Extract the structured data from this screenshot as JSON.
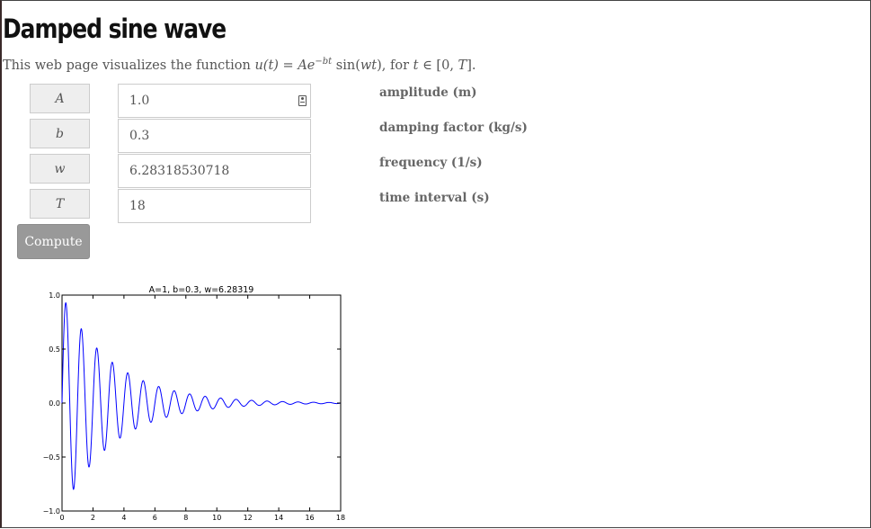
{
  "page": {
    "title": "Damped sine wave",
    "intro_prefix": "This web page visualizes the function ",
    "intro_func_lhs": "u(t)",
    "intro_eq": " = ",
    "intro_func_A": "Ae",
    "intro_func_exp": "−bt",
    "intro_sin": " sin(",
    "intro_wt": "wt",
    "intro_close": "),",
    "intro_for": "  for ",
    "intro_t": "t",
    "intro_in": " ∈ [0, ",
    "intro_T": "T",
    "intro_end": "]."
  },
  "form": {
    "params": [
      {
        "symbol": "A",
        "value": "1.0",
        "description": "amplitude (m)"
      },
      {
        "symbol": "b",
        "value": "0.3",
        "description": "damping factor (kg/s)"
      },
      {
        "symbol": "w",
        "value": "6.28318530718",
        "description": "frequency (1/s)"
      },
      {
        "symbol": "T",
        "value": "18",
        "description": "time interval (s)"
      }
    ],
    "compute_label": "Compute",
    "autofill_icon": "contact-card-icon"
  },
  "chart_data": {
    "type": "line",
    "title": "A=1, b=0.3, w=6.28319",
    "xlabel": "",
    "ylabel": "",
    "xlim": [
      0,
      18
    ],
    "ylim": [
      -1.0,
      1.0
    ],
    "x_ticks": [
      "0",
      "2",
      "4",
      "6",
      "8",
      "10",
      "12",
      "14",
      "16",
      "18"
    ],
    "y_ticks": [
      "1.0",
      "0.5",
      "0.0",
      "−0.5",
      "−1.0"
    ],
    "grid": false,
    "series": [
      {
        "color": "#0000ff",
        "function": "u(t) = A*exp(-b*t)*sin(w*t)",
        "A": 1.0,
        "b": 0.3,
        "w": 6.28318530718,
        "t_start": 0,
        "t_end": 18
      }
    ]
  }
}
